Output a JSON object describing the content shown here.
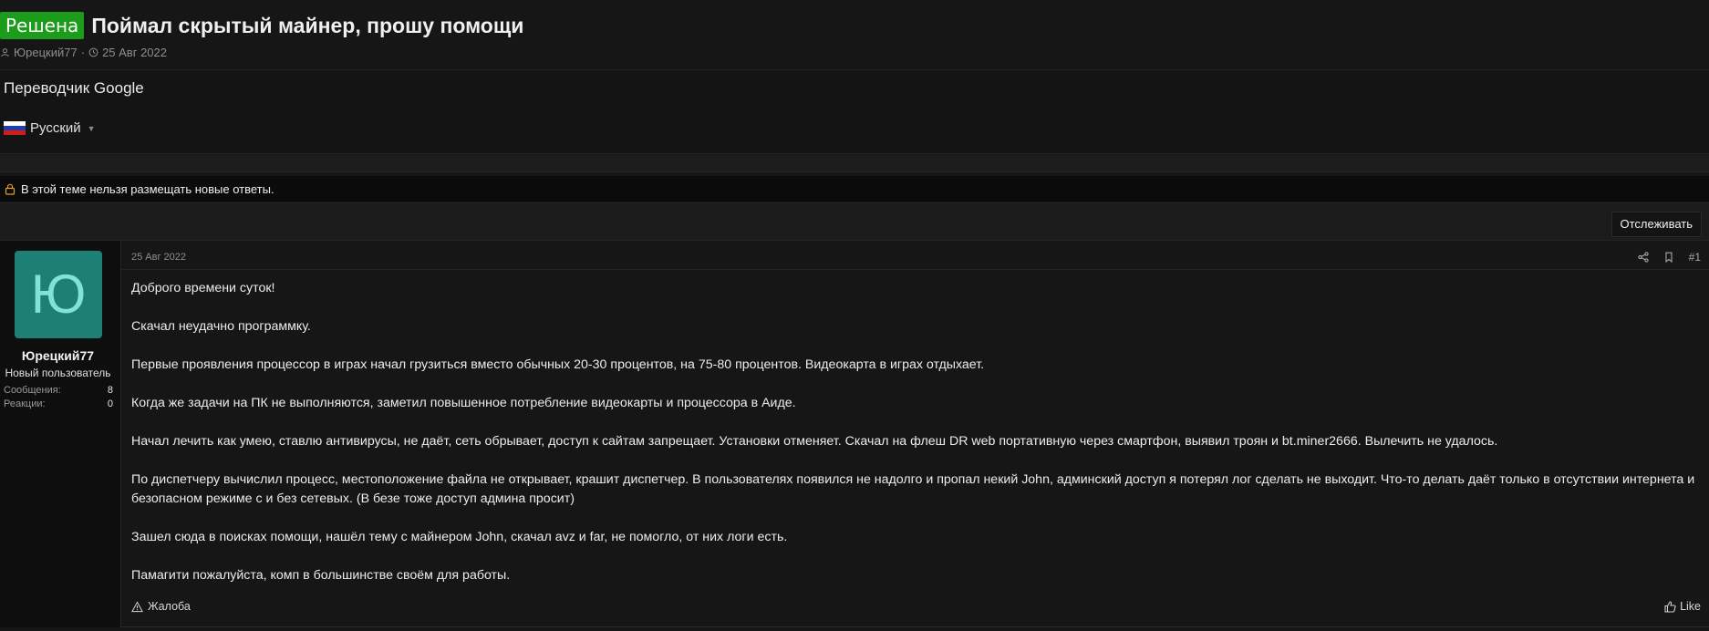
{
  "thread": {
    "badge": "Решена",
    "title": "Поймал скрытый майнер, прошу помощи",
    "author": "Юрецкий77",
    "separator": "·",
    "date": "25 Авг 2022"
  },
  "translator": {
    "title": "Переводчик Google",
    "language": "Русский",
    "flag_colors": [
      "#ffffff",
      "#1f3fb0",
      "#d21c1c"
    ]
  },
  "notice": {
    "text": "В этой теме нельзя размещать новые ответы.",
    "icon": "lock-icon",
    "icon_color": "#e0a030"
  },
  "actions": {
    "watch_label": "Отслеживать"
  },
  "post": {
    "user": {
      "avatar_letter": "Ю",
      "avatar_color": "#1e7f74",
      "name": "Юрецкий77",
      "title": "Новый пользователь",
      "stats": [
        {
          "label": "Сообщения:",
          "value": "8"
        },
        {
          "label": "Реакции:",
          "value": "0"
        }
      ]
    },
    "date": "25 Авг 2022",
    "number": "#1",
    "paragraphs": [
      "Доброго времени суток!",
      "Скачал неудачно программку.",
      "Первые проявления процессор в играх начал грузиться вместо обычных 20-30 процентов, на 75-80 процентов. Видеокарта в играх отдыхает.",
      "Когда же задачи на ПК не выполняются, заметил повышенное потребление видеокарты и процессора в Аиде.",
      "Начал лечить как умею, ставлю антивирусы, не даёт, сеть обрывает, доступ к сайтам запрещает. Установки отменяет. Скачал на флеш DR web портативную через смартфон, выявил троян и bt.miner2666. Вылечить не удалось.",
      "По диспетчеру вычислил процесс, местоположение файла не открывает, крашит диспетчер. В пользователях появился не надолго и пропал некий John, админский доступ я потерял лог сделать не выходит. Что-то делать даёт только в отсутствии интернета и безопасном режиме с и без сетевых. (В безе тоже доступ админа просит)",
      "Зашел сюда в поисках помощи, нашёл тему с майнером John, скачал avz и far, не помогло, от них логи есть.",
      "Памагити пожалуйста, комп в большинстве своём для работы."
    ],
    "report_label": "Жалоба",
    "like_label": "Like"
  }
}
